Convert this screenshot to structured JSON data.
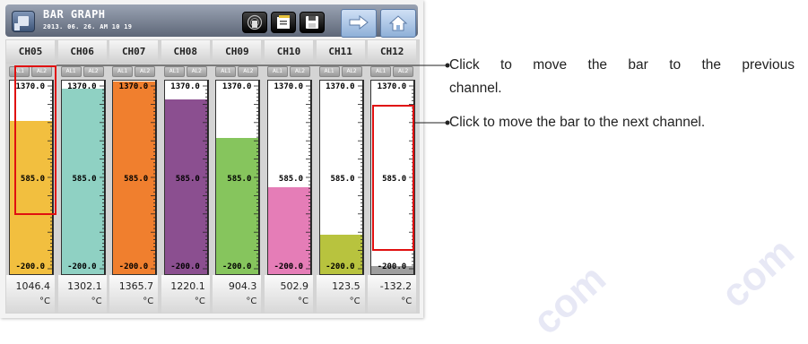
{
  "header": {
    "title": "BAR GRAPH",
    "datetime": "2013. 06. 26. AM 10 19"
  },
  "toolbar": {
    "buttons": [
      "record-icon",
      "folder-icon",
      "save-icon",
      "next-page-arrow-icon",
      "home-icon"
    ]
  },
  "scale": {
    "max_label": "1370.0",
    "mid_label": "585.0",
    "min_label": "-200.0",
    "min": -200,
    "max": 1370
  },
  "alarms": {
    "al1": "AL1",
    "al2": "AL2"
  },
  "channels": [
    {
      "name": "CH05",
      "value": "1046.4",
      "unit": "°C",
      "level": 1046.4,
      "color": "#f2bf3f"
    },
    {
      "name": "CH06",
      "value": "1302.1",
      "unit": "°C",
      "level": 1302.1,
      "color": "#8fd1c3"
    },
    {
      "name": "CH07",
      "value": "1365.7",
      "unit": "°C",
      "level": 1365.7,
      "color": "#f07f2e"
    },
    {
      "name": "CH08",
      "value": "1220.1",
      "unit": "°C",
      "level": 1220.1,
      "color": "#8b4f90"
    },
    {
      "name": "CH09",
      "value": "904.3",
      "unit": "°C",
      "level": 904.3,
      "color": "#86c55d"
    },
    {
      "name": "CH10",
      "value": "502.9",
      "unit": "°C",
      "level": 502.9,
      "color": "#e57db7"
    },
    {
      "name": "CH11",
      "value": "123.5",
      "unit": "°C",
      "level": 123.5,
      "color": "#b8c33e"
    },
    {
      "name": "CH12",
      "value": "-132.2",
      "unit": "°C",
      "level": -132.2,
      "color": "#9e9e9e"
    }
  ],
  "annotations": {
    "prev_line1": "Click to move the bar to the previous",
    "prev_line2": "channel.",
    "next": "Click to move the bar to the next channel."
  },
  "colors": {
    "highlight": "#e01010",
    "header": "#6f7888"
  }
}
